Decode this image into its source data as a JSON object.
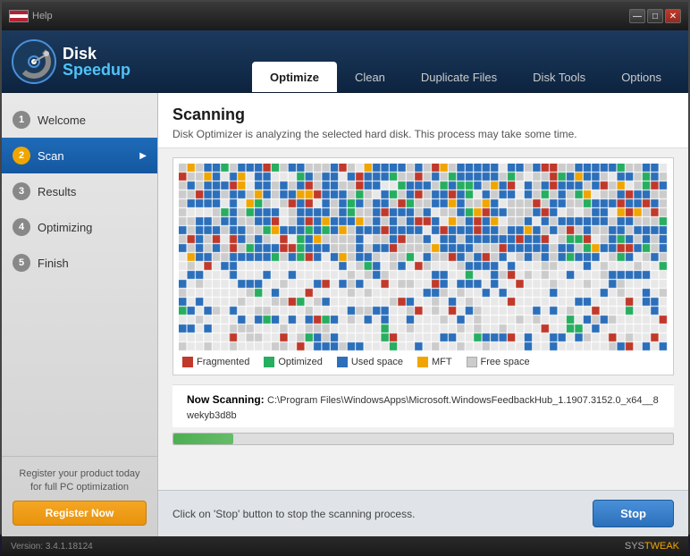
{
  "titlebar": {
    "help_label": "Help",
    "minimize_label": "—",
    "maximize_label": "□",
    "close_label": "✕"
  },
  "app": {
    "name_disk": "Disk",
    "name_speedup": "Speedup"
  },
  "nav_tabs": [
    {
      "id": "optimize",
      "label": "Optimize",
      "active": true
    },
    {
      "id": "clean",
      "label": "Clean",
      "active": false
    },
    {
      "id": "duplicate",
      "label": "Duplicate Files",
      "active": false
    },
    {
      "id": "disk_tools",
      "label": "Disk Tools",
      "active": false
    },
    {
      "id": "options",
      "label": "Options",
      "active": false
    }
  ],
  "sidebar": {
    "items": [
      {
        "step": "1",
        "label": "Welcome",
        "active": false,
        "arrow": false
      },
      {
        "step": "2",
        "label": "Scan",
        "active": true,
        "arrow": true
      },
      {
        "step": "3",
        "label": "Results",
        "active": false,
        "arrow": false
      },
      {
        "step": "4",
        "label": "Optimizing",
        "active": false,
        "arrow": false
      },
      {
        "step": "5",
        "label": "Finish",
        "active": false,
        "arrow": false
      }
    ],
    "footer_text": "Register your product today for full PC optimization",
    "register_label": "Register Now"
  },
  "content": {
    "title": "Scanning",
    "description": "Disk Optimizer is analyzing the selected hard disk. This process may take some time.",
    "scanning_label": "Now Scanning:",
    "scanning_path": "C:\\Program Files\\WindowsApps\\Microsoft.WindowsFeedbackHub_1.1907.3152.0_x64__8wekyb3d8b",
    "progress_percent": 12,
    "bottom_hint": "Click on 'Stop' button to stop the scanning process.",
    "stop_label": "Stop"
  },
  "legend": [
    {
      "label": "Fragmented",
      "color": "#c0392b"
    },
    {
      "label": "Optimized",
      "color": "#27ae60"
    },
    {
      "label": "Used space",
      "color": "#2c6fba"
    },
    {
      "label": "MFT",
      "color": "#f0a500"
    },
    {
      "label": "Free space",
      "color": "#cccccc"
    }
  ],
  "footer": {
    "version": "Version: 3.4.1.18124",
    "brand_sys": "SYS",
    "brand_tweak": "TWEAK"
  }
}
